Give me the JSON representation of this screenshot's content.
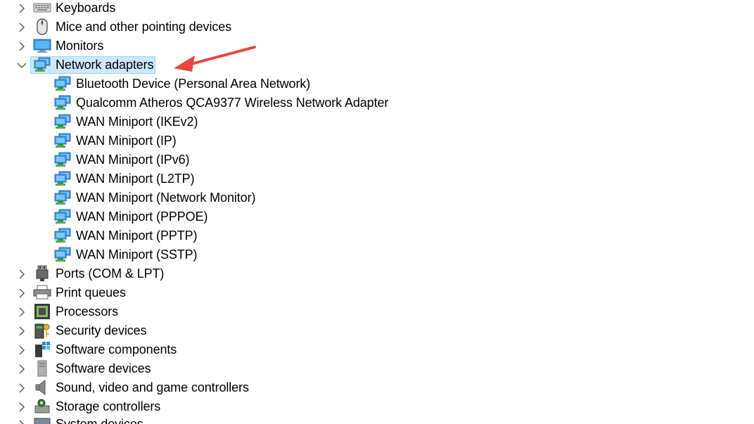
{
  "tree": {
    "nodes": [
      {
        "label": "Keyboards",
        "icon": "keyboard-icon",
        "expanded": false
      },
      {
        "label": "Mice and other pointing devices",
        "icon": "mouse-icon",
        "expanded": false
      },
      {
        "label": "Monitors",
        "icon": "monitor-icon",
        "expanded": false
      },
      {
        "label": "Network adapters",
        "icon": "network-adapter-icon",
        "expanded": true,
        "selected": true
      },
      {
        "label": "Bluetooth Device (Personal Area Network)",
        "icon": "network-adapter-icon",
        "child": true
      },
      {
        "label": "Qualcomm Atheros QCA9377 Wireless Network Adapter",
        "icon": "network-adapter-icon",
        "child": true
      },
      {
        "label": "WAN Miniport (IKEv2)",
        "icon": "network-adapter-icon",
        "child": true
      },
      {
        "label": "WAN Miniport (IP)",
        "icon": "network-adapter-icon",
        "child": true
      },
      {
        "label": "WAN Miniport (IPv6)",
        "icon": "network-adapter-icon",
        "child": true
      },
      {
        "label": "WAN Miniport (L2TP)",
        "icon": "network-adapter-icon",
        "child": true
      },
      {
        "label": "WAN Miniport (Network Monitor)",
        "icon": "network-adapter-icon",
        "child": true
      },
      {
        "label": "WAN Miniport (PPPOE)",
        "icon": "network-adapter-icon",
        "child": true
      },
      {
        "label": "WAN Miniport (PPTP)",
        "icon": "network-adapter-icon",
        "child": true
      },
      {
        "label": "WAN Miniport (SSTP)",
        "icon": "network-adapter-icon",
        "child": true
      },
      {
        "label": "Ports (COM & LPT)",
        "icon": "port-icon",
        "expanded": false
      },
      {
        "label": "Print queues",
        "icon": "printer-icon",
        "expanded": false
      },
      {
        "label": "Processors",
        "icon": "processor-icon",
        "expanded": false
      },
      {
        "label": "Security devices",
        "icon": "security-key-icon",
        "expanded": false
      },
      {
        "label": "Software components",
        "icon": "software-component-icon",
        "expanded": false
      },
      {
        "label": "Software devices",
        "icon": "software-device-icon",
        "expanded": false
      },
      {
        "label": "Sound, video and game controllers",
        "icon": "speaker-icon",
        "expanded": false
      },
      {
        "label": "Storage controllers",
        "icon": "storage-controller-icon",
        "expanded": false
      },
      {
        "label": "System devices",
        "icon": "system-device-icon",
        "expanded": false
      }
    ]
  },
  "colors": {
    "selection_fill": "#cce8ff",
    "selection_border": "#99d1ff",
    "annotation_arrow": "#e8443a",
    "chevron": "#555555"
  }
}
